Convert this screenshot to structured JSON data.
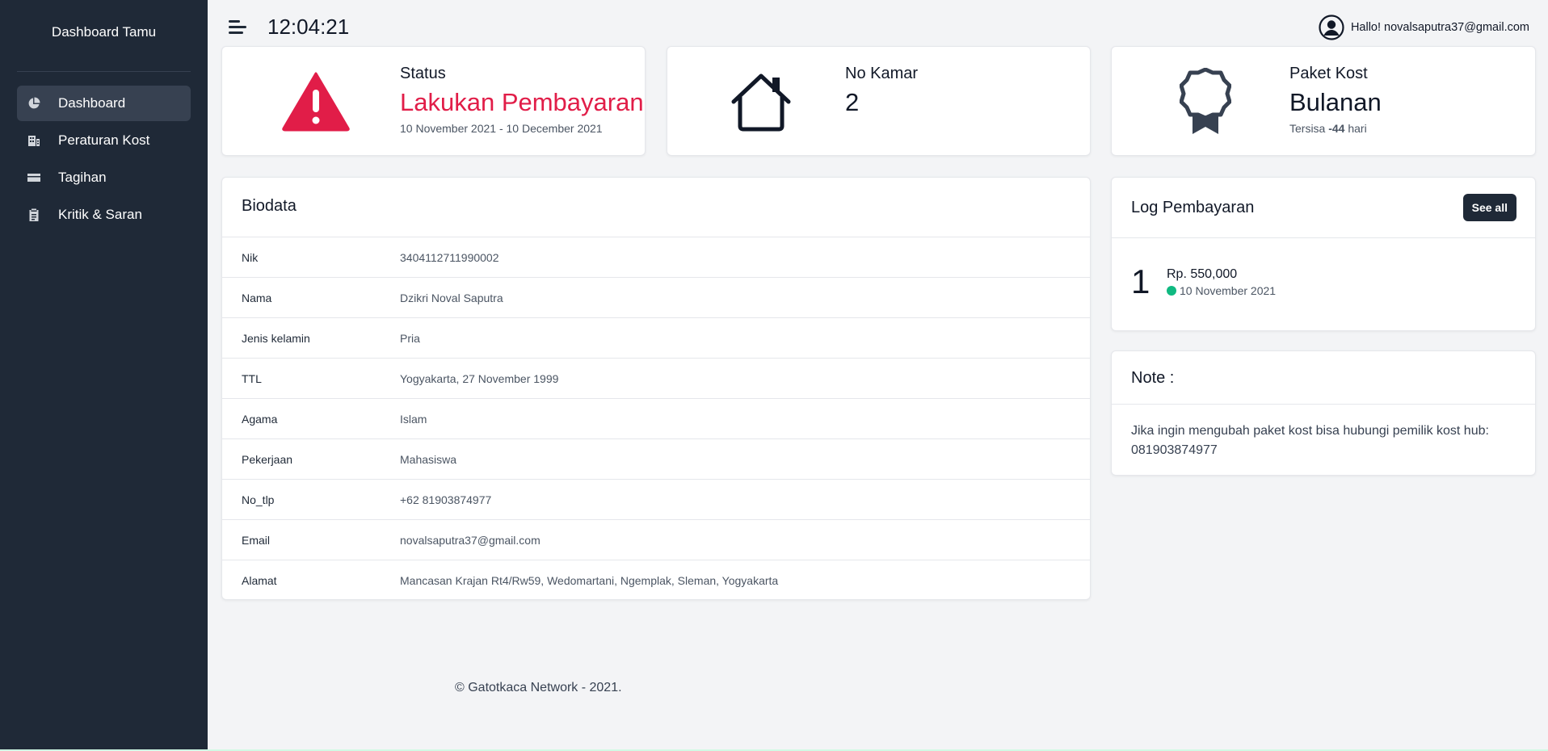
{
  "sidebar": {
    "title": "Dashboard Tamu",
    "items": [
      {
        "label": "Dashboard",
        "icon": "pie-chart-icon",
        "active": true
      },
      {
        "label": "Peraturan Kost",
        "icon": "building-icon"
      },
      {
        "label": "Tagihan",
        "icon": "credit-card-icon"
      },
      {
        "label": "Kritik & Saran",
        "icon": "clipboard-icon"
      }
    ]
  },
  "header": {
    "clock": "12:04:21",
    "greeting": "Hallo! novalsaputra37@gmail.com"
  },
  "stats": {
    "status": {
      "label": "Status",
      "value": "Lakukan Pembayaran",
      "sub": "10 November 2021 - 10 December 2021",
      "color": "#e11d48",
      "icon": "warning-triangle-icon"
    },
    "room": {
      "label": "No Kamar",
      "value": "2",
      "icon": "house-icon"
    },
    "package": {
      "label": "Paket Kost",
      "value": "Bulanan",
      "sub_prefix": "Tersisa ",
      "sub_bold": "-44",
      "sub_suffix": " hari",
      "icon": "award-badge-icon"
    }
  },
  "biodata": {
    "title": "Biodata",
    "rows": [
      {
        "key": "Nik",
        "value": "3404112711990002"
      },
      {
        "key": "Nama",
        "value": "Dzikri Noval Saputra"
      },
      {
        "key": "Jenis kelamin",
        "value": "Pria"
      },
      {
        "key": "TTL",
        "value": "Yogyakarta, 27 November 1999"
      },
      {
        "key": "Agama",
        "value": "Islam"
      },
      {
        "key": "Pekerjaan",
        "value": "Mahasiswa"
      },
      {
        "key": "No_tlp",
        "value": "+62 81903874977"
      },
      {
        "key": "Email",
        "value": "novalsaputra37@gmail.com"
      },
      {
        "key": "Alamat",
        "value": "Mancasan Krajan Rt4/Rw59, Wedomartani, Ngemplak, Sleman, Yogyakarta"
      }
    ]
  },
  "log": {
    "title": "Log Pembayaran",
    "see_all": "See all",
    "entries": [
      {
        "number": "1",
        "amount": "Rp. 550,000",
        "date": "10 November 2021",
        "status_color": "#10b981"
      }
    ]
  },
  "note": {
    "title": "Note :",
    "body": "Jika ingin mengubah paket kost bisa hubungi pemilik kost hub: 081903874977"
  },
  "footer": "© Gatotkaca Network - 2021."
}
